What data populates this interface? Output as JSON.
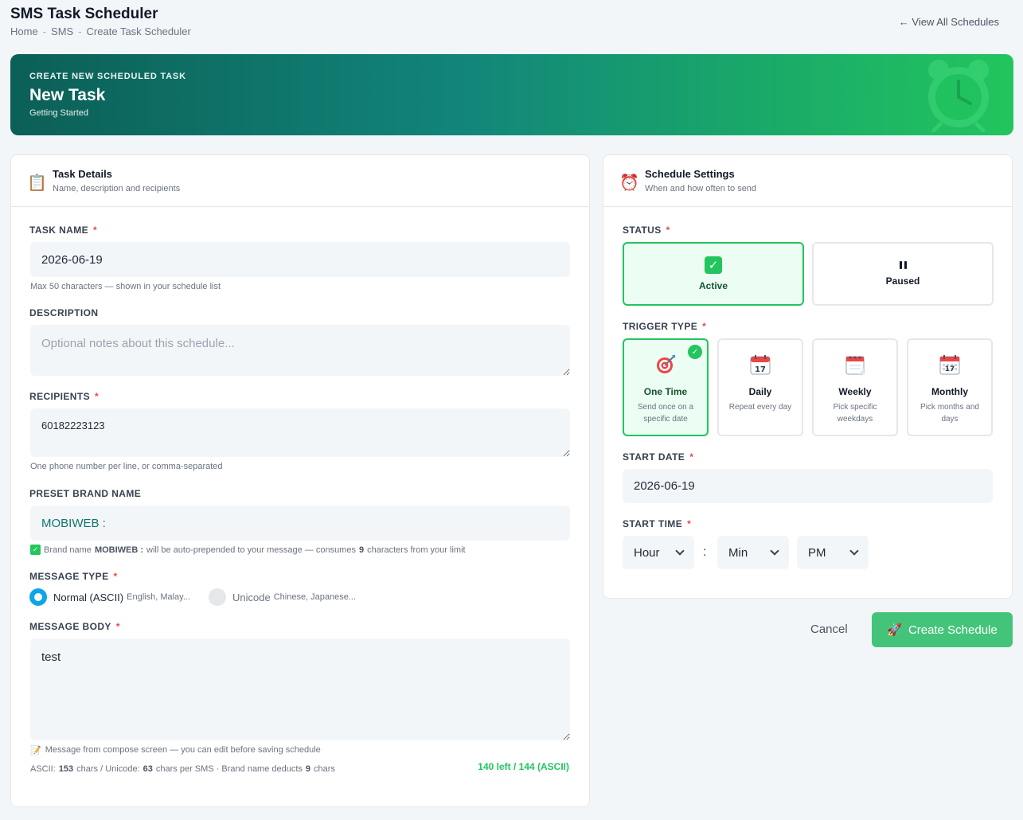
{
  "header": {
    "title": "SMS Task Scheduler",
    "breadcrumb": [
      "Home",
      "SMS",
      "Create Task Scheduler"
    ],
    "breadcrumb_sep": "-",
    "view_all": "← View All Schedules"
  },
  "hero": {
    "kicker": "CREATE NEW SCHEDULED TASK",
    "title": "New Task",
    "subtitle": "Getting Started",
    "icon": "alarm-clock-icon"
  },
  "task_details": {
    "icon": "clipboard-icon",
    "title": "Task Details",
    "description": "Name, description and recipients",
    "task_name": {
      "label": "TASK NAME",
      "required": "*",
      "value": "2026-06-19",
      "hint": "Max 50 characters — shown in your schedule list"
    },
    "description_field": {
      "label": "DESCRIPTION",
      "placeholder": "Optional notes about this schedule..."
    },
    "recipients": {
      "label": "RECIPIENTS",
      "required": "*",
      "value": "60182223123",
      "hint": "One phone number per line, or comma-separated"
    },
    "brand": {
      "label": "PRESET BRAND NAME",
      "value": "MOBIWEB :",
      "note_prefix": "Brand name",
      "note_brand": "MOBIWEB :",
      "note_middle": "will be auto-prepended to your message — consumes",
      "note_count": "9",
      "note_suffix": "characters from your limit"
    },
    "message_type": {
      "label": "MESSAGE TYPE",
      "required": "*",
      "options": [
        {
          "label": "Normal (ASCII)",
          "sub": "English, Malay...",
          "selected": true
        },
        {
          "label": "Unicode",
          "sub": "Chinese, Japanese...",
          "selected": false
        }
      ]
    },
    "message_body": {
      "label": "MESSAGE BODY",
      "required": "*",
      "value": "test",
      "compose_note": "Message from compose screen — you can edit before saving schedule",
      "stats": {
        "ascii_label": "ASCII:",
        "ascii_value": "153",
        "ascii_unit": "chars / Unicode:",
        "unicode_value": "63",
        "unicode_unit": "chars per SMS · Brand name deducts",
        "brand_deduct": "9",
        "brand_unit": "chars"
      },
      "counter": "140 left / 144 (ASCII)"
    }
  },
  "schedule": {
    "icon": "alarm-clock-icon",
    "title": "Schedule Settings",
    "description": "When and how often to send",
    "status": {
      "label": "STATUS",
      "required": "*",
      "options": [
        {
          "label": "Active",
          "selected": true
        },
        {
          "label": "Paused",
          "selected": false
        }
      ]
    },
    "trigger": {
      "label": "TRIGGER TYPE",
      "required": "*",
      "options": [
        {
          "name": "One Time",
          "desc": "Send once on a specific date",
          "icon": "target-icon",
          "selected": true
        },
        {
          "name": "Daily",
          "desc": "Repeat every day",
          "icon": "calendar-icon",
          "selected": false
        },
        {
          "name": "Weekly",
          "desc": "Pick specific weekdays",
          "icon": "spiral-calendar-icon",
          "selected": false
        },
        {
          "name": "Monthly",
          "desc": "Pick months and days",
          "icon": "calendar-grid-icon",
          "selected": false
        }
      ]
    },
    "start_date": {
      "label": "START DATE",
      "required": "*",
      "value": "2026-06-19"
    },
    "start_time": {
      "label": "START TIME",
      "required": "*",
      "hour": "Hour",
      "separator": ":",
      "minute": "Min",
      "period": "PM"
    }
  },
  "actions": {
    "cancel": "Cancel",
    "create": "Create Schedule",
    "create_icon": "rocket-icon"
  },
  "colors": {
    "accent": "#22c55e",
    "teal": "#0f766e",
    "radio": "#0ea5e9",
    "required": "#ef4444"
  }
}
